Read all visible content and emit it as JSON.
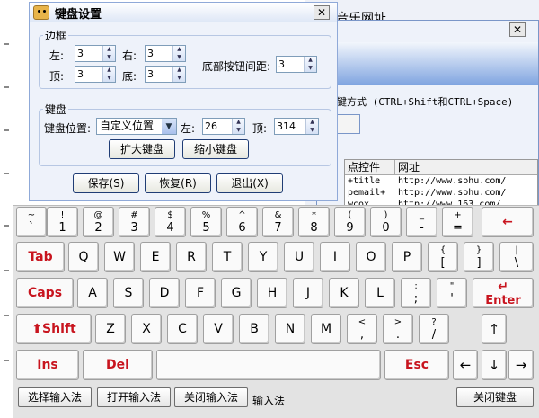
{
  "background_window": {
    "title": "音乐网址",
    "close_label": "✕",
    "shortcut_text": "键方式 (CTRL+Shift和CTRL+Space)",
    "table": {
      "headers": [
        "点控件",
        "网址"
      ],
      "rows": [
        [
          "+title",
          "http://www.sohu.com/"
        ],
        [
          "pemail+",
          "http://www.sohu.com/"
        ],
        [
          "wcox",
          "http://www.163.com/"
        ]
      ]
    }
  },
  "settings_dialog": {
    "title": "键盘设置",
    "close_label": "✕",
    "border_group": {
      "legend": "边框",
      "left_label": "左:",
      "left_value": "3",
      "right_label": "右:",
      "right_value": "3",
      "top_label": "顶:",
      "top_value": "3",
      "bottom_label": "底:",
      "bottom_value": "3",
      "button_spacing_label": "底部按钮间距:",
      "button_spacing_value": "3"
    },
    "keyboard_group": {
      "legend": "键盘",
      "position_label": "键盘位置:",
      "position_value": "自定义位置",
      "left_label": "左:",
      "left_value": "26",
      "top_label": "顶:",
      "top_value": "314",
      "enlarge_label": "扩大键盘",
      "shrink_label": "缩小键盘"
    },
    "save_label": "保存(S)",
    "restore_label": "恢复(R)",
    "exit_label": "退出(X)"
  },
  "keyboard": {
    "row1": [
      {
        "t": "~",
        "b": "`"
      },
      {
        "t": "!",
        "b": "1"
      },
      {
        "t": "@",
        "b": "2"
      },
      {
        "t": "#",
        "b": "3"
      },
      {
        "t": "$",
        "b": "4"
      },
      {
        "t": "%",
        "b": "5"
      },
      {
        "t": "^",
        "b": "6"
      },
      {
        "t": "&",
        "b": "7"
      },
      {
        "t": "*",
        "b": "8"
      },
      {
        "t": "(",
        "b": "9"
      },
      {
        "t": ")",
        "b": "0"
      },
      {
        "t": "_",
        "b": "-"
      },
      {
        "t": "+",
        "b": "="
      }
    ],
    "backspace_glyph": "←",
    "tab_label": "Tab",
    "row2": [
      "Q",
      "W",
      "E",
      "R",
      "T",
      "Y",
      "U",
      "I",
      "O",
      "P"
    ],
    "row2_symbols": [
      {
        "t": "{",
        "b": "["
      },
      {
        "t": "}",
        "b": "]"
      },
      {
        "t": "|",
        "b": "\\"
      }
    ],
    "caps_label": "Caps",
    "row3": [
      "A",
      "S",
      "D",
      "F",
      "G",
      "H",
      "J",
      "K",
      "L"
    ],
    "row3_symbols": [
      {
        "t": ":",
        "b": ";"
      },
      {
        "t": "\"",
        "b": "'"
      }
    ],
    "enter_glyph": "↵",
    "enter_label": "Enter",
    "shift_glyph": "⬆",
    "shift_label": "Shift",
    "row4": [
      "Z",
      "X",
      "C",
      "V",
      "B",
      "N",
      "M"
    ],
    "row4_symbols": [
      {
        "t": "<",
        "b": ","
      },
      {
        "t": ">",
        "b": "."
      },
      {
        "t": "?",
        "b": "/"
      }
    ],
    "up_glyph": "↑",
    "ins_label": "Ins",
    "del_label": "Del",
    "esc_label": "Esc",
    "left_glyph": "←",
    "down_glyph": "↓",
    "right_glyph": "→"
  },
  "bottom_bar": {
    "select_ime": "选择输入法",
    "open_ime": "打开输入法",
    "close_ime": "关闭输入法",
    "ime_status": "输入法",
    "close_keyboard": "关闭键盘"
  }
}
